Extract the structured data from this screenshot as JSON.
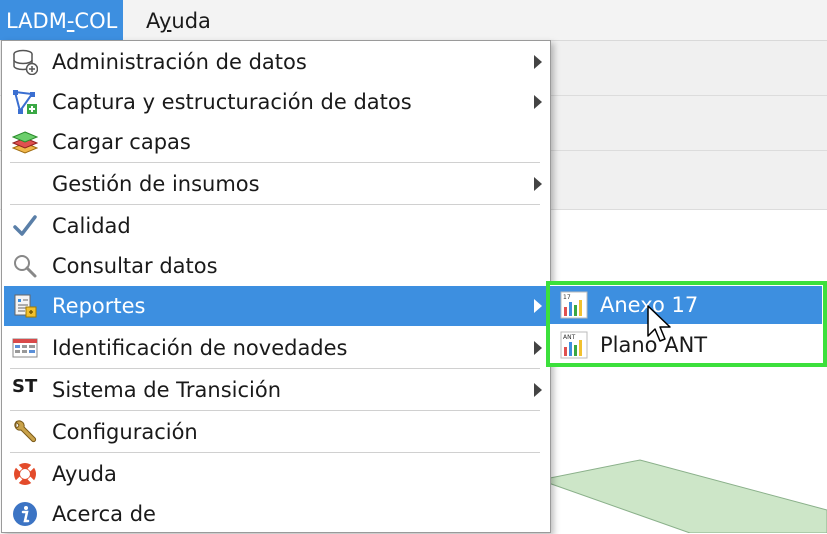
{
  "menubar": {
    "items": [
      {
        "label_pre": "LADM",
        "mnemonic": "-",
        "label_post": "COL"
      },
      {
        "label_pre": "A",
        "mnemonic": "y",
        "label_post": "uda"
      }
    ]
  },
  "menu": {
    "items": [
      {
        "label": "Administración de datos",
        "icon": "database-add-icon",
        "submenu": true
      },
      {
        "label": "Captura y estructuración de datos",
        "icon": "polygon-edit-icon",
        "submenu": true
      },
      {
        "label": "Cargar capas",
        "icon": "layers-icon",
        "submenu": false
      },
      {
        "label": "Gestión de insumos",
        "icon": "",
        "submenu": true
      },
      {
        "label": "Calidad",
        "icon": "checkmark-icon",
        "submenu": false
      },
      {
        "label": "Consultar datos",
        "icon": "magnifier-icon",
        "submenu": false
      },
      {
        "label": "Reportes",
        "icon": "report-icon",
        "submenu": true
      },
      {
        "label": "Identificación de novedades",
        "icon": "table-icon",
        "submenu": true
      },
      {
        "label": "Sistema de Transición",
        "icon": "st-icon",
        "icon_text": "ST",
        "submenu": true
      },
      {
        "label": "Configuración",
        "icon": "wrench-icon",
        "submenu": false
      },
      {
        "label": "Ayuda",
        "icon": "lifebuoy-icon",
        "submenu": false
      },
      {
        "label": "Acerca de",
        "icon": "info-icon",
        "submenu": false
      }
    ],
    "highlighted_index": 6
  },
  "submenu": {
    "items": [
      {
        "label": "Anexo 17",
        "icon": "report-chart-icon",
        "icon_caption": "17"
      },
      {
        "label": "Plano ANT",
        "icon": "report-chart-icon",
        "icon_caption": "ANT"
      }
    ],
    "highlighted_index": 0
  },
  "colors": {
    "highlight": "#3d8fe0",
    "annotation_frame": "#3ce03c"
  }
}
